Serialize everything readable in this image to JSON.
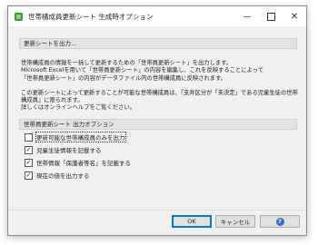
{
  "window": {
    "title": "世帯構成員更新シート 生成時オプション",
    "minimize_icon": "minimize-icon",
    "maximize_icon": "maximize-icon",
    "close_icon": "close-icon"
  },
  "section1": {
    "header": "更新シートを出力..."
  },
  "description": {
    "line1": "世帯構成員の情報を一括して更新するための「世帯員更新シート」を出力します。",
    "line2": "Microsoft Excelを用いて「世帯員更新シート」の内容を編集し、これを反映することによって",
    "line3": "「世帯員更新シート」の内容がデータファイル内の世帯構成員に反映されます。",
    "line4": "この更新シートによって更新することが可能な世帯構成員は、『支弁区分が「未決定」である児童生徒の世帯",
    "line5": "構成員』に限られます。",
    "line6": "詳しくはオンラインヘルプをご覧ください。"
  },
  "section2": {
    "header": "世帯員更新シート 出力オプション"
  },
  "options": [
    {
      "label": "更新可能な世帯構成員のみを出力",
      "checked": false
    },
    {
      "label": "児童生徒情報を記載する",
      "checked": true
    },
    {
      "label": "世帯情報「保護者等名」を記載する",
      "checked": true
    },
    {
      "label": "現在の値を出力する",
      "checked": true
    }
  ],
  "buttons": {
    "ok": "OK",
    "cancel": "キャンセル",
    "help_icon": "help-icon",
    "help_glyph": "?"
  }
}
